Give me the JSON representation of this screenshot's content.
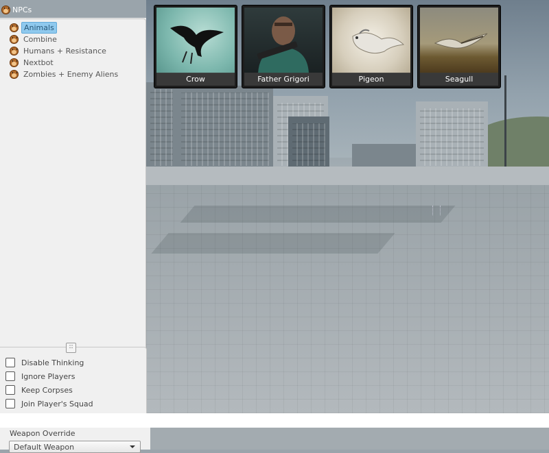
{
  "tree": {
    "root_label": "NPCs",
    "items": [
      {
        "label": "Animals",
        "selected": true
      },
      {
        "label": "Combine",
        "selected": false
      },
      {
        "label": "Humans + Resistance",
        "selected": false
      },
      {
        "label": "Nextbot",
        "selected": false
      },
      {
        "label": "Zombies + Enemy Aliens",
        "selected": false
      }
    ]
  },
  "options": {
    "splitter_glyph": "::",
    "checkboxes": [
      {
        "label": "Disable Thinking",
        "checked": false
      },
      {
        "label": "Ignore Players",
        "checked": false
      },
      {
        "label": "Keep Corpses",
        "checked": false
      },
      {
        "label": "Join Player's Squad",
        "checked": false
      }
    ],
    "weapon_override_label": "Weapon Override",
    "weapon_override_value": "Default Weapon"
  },
  "npcs": [
    {
      "name": "Crow"
    },
    {
      "name": "Father Grigori"
    },
    {
      "name": "Pigeon"
    },
    {
      "name": "Seagull"
    }
  ],
  "colors": {
    "selection": "#8fc9ee",
    "panel_bg": "#f0f0f0",
    "card_caption_bg": "#3c3c3c"
  }
}
